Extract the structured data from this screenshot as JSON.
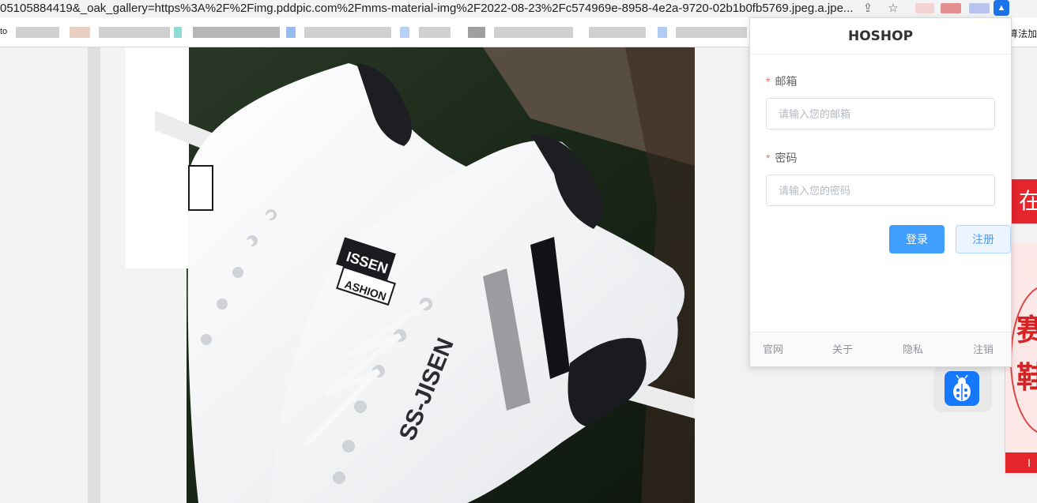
{
  "browser": {
    "url_text": "05105884419&_oak_gallery=https%3A%2F%2Fimg.pddpic.com%2Fmms-material-img%2F2022-08-23%2Fc574969e-8958-4e2a-9720-02b1b0fb5769.jpeg.a.jpe...",
    "share_icon": "share-icon",
    "bookmark_icon": "star-icon",
    "bookmarks_left_text": "to",
    "bookmarks_right_text": "算法加"
  },
  "popup": {
    "title": "HOSHOP",
    "email": {
      "label": "邮箱",
      "required_mark": "*",
      "placeholder": "请输入您的邮箱",
      "value": ""
    },
    "password": {
      "label": "密码",
      "required_mark": "*",
      "placeholder": "请输入您的密码",
      "value": ""
    },
    "login_label": "登录",
    "register_label": "注册",
    "footer": [
      "官网",
      "关于",
      "隐私",
      "注销"
    ],
    "accent_color": "#409eff"
  },
  "product_image": {
    "brand_text_1": "SS-JISEN",
    "brand_text_2": "ISSEN",
    "brand_text_3": "ASHION"
  },
  "side_ads": {
    "banner_char": "在",
    "ad_chars": [
      "赛",
      "鞋"
    ],
    "ad_bottom_text": "I"
  }
}
